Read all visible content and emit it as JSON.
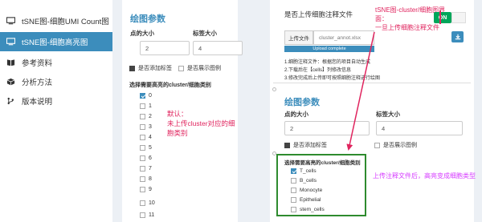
{
  "sidebar": {
    "items": [
      {
        "label": "tSNE图-细胞UMI Count图",
        "icon": "monitor-icon",
        "active": false
      },
      {
        "label": "tSNE图-细胞高亮图",
        "icon": "monitor-icon",
        "active": true
      },
      {
        "label": "参考资料",
        "icon": "book-icon",
        "active": false
      },
      {
        "label": "分析方法",
        "icon": "cube-icon",
        "active": false
      },
      {
        "label": "版本说明",
        "icon": "branch-icon",
        "active": false
      }
    ]
  },
  "left_panel": {
    "title": "绘图参数",
    "point_size_label": "点的大小",
    "point_size_value": "2",
    "label_size_label": "标签大小",
    "label_size_value": "4",
    "add_label": "是否添加标签",
    "show_legend": "是否展示图例",
    "cluster_header": "选择需要高亮的cluster/细胞类别",
    "clusters": [
      "0",
      "1",
      "2",
      "3",
      "4",
      "5",
      "6",
      "7",
      "8",
      "9",
      "10",
      "11"
    ],
    "annotation": "默认：\n未上传cluster对应的细胞类别"
  },
  "right_panel": {
    "upload_question": "是否上传细胞注释文件",
    "toggle_on": "ON",
    "annotation_top": "tSNE图-cluster/细胞图界面：\n一旦上传细胞注释文件",
    "upload_button": "上传文件",
    "file_name": "cluster_annot.xlsx",
    "progress_text": "Upload complete",
    "progress_percent": 100,
    "notes": [
      "1.细胞注释文件：根据您的项目自动生成",
      "2.下载后在【cells】列修改信息",
      "3.修改完成后上传即可按照细胞注释进行绘图"
    ],
    "title": "绘图参数",
    "point_size_label": "点的大小",
    "point_size_value": "2",
    "label_size_label": "标签大小",
    "label_size_value": "4",
    "add_label": "是否添加标签",
    "show_legend": "是否展示图例",
    "cluster_header": "选择需要高亮的cluster/细胞类别",
    "cell_types": [
      "T_cells",
      "B_cells",
      "Monocyte",
      "Epithelial",
      "stem_cells"
    ],
    "annotation_bottom": "上传注释文件后，高亮变成细胞类型"
  },
  "colors": {
    "accent": "#3c8dbc",
    "annotation_red": "#e0245e",
    "annotation_magenta": "#d63bff",
    "toggle_green": "#00a65a",
    "highlight_box": "#2e8b2e"
  }
}
